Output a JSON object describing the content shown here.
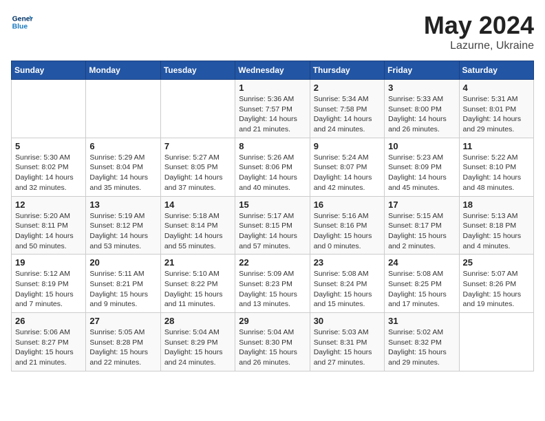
{
  "header": {
    "logo_line1": "General",
    "logo_line2": "Blue",
    "month": "May 2024",
    "location": "Lazurne, Ukraine"
  },
  "weekdays": [
    "Sunday",
    "Monday",
    "Tuesday",
    "Wednesday",
    "Thursday",
    "Friday",
    "Saturday"
  ],
  "weeks": [
    [
      {
        "day": "",
        "info": ""
      },
      {
        "day": "",
        "info": ""
      },
      {
        "day": "",
        "info": ""
      },
      {
        "day": "1",
        "info": "Sunrise: 5:36 AM\nSunset: 7:57 PM\nDaylight: 14 hours\nand 21 minutes."
      },
      {
        "day": "2",
        "info": "Sunrise: 5:34 AM\nSunset: 7:58 PM\nDaylight: 14 hours\nand 24 minutes."
      },
      {
        "day": "3",
        "info": "Sunrise: 5:33 AM\nSunset: 8:00 PM\nDaylight: 14 hours\nand 26 minutes."
      },
      {
        "day": "4",
        "info": "Sunrise: 5:31 AM\nSunset: 8:01 PM\nDaylight: 14 hours\nand 29 minutes."
      }
    ],
    [
      {
        "day": "5",
        "info": "Sunrise: 5:30 AM\nSunset: 8:02 PM\nDaylight: 14 hours\nand 32 minutes."
      },
      {
        "day": "6",
        "info": "Sunrise: 5:29 AM\nSunset: 8:04 PM\nDaylight: 14 hours\nand 35 minutes."
      },
      {
        "day": "7",
        "info": "Sunrise: 5:27 AM\nSunset: 8:05 PM\nDaylight: 14 hours\nand 37 minutes."
      },
      {
        "day": "8",
        "info": "Sunrise: 5:26 AM\nSunset: 8:06 PM\nDaylight: 14 hours\nand 40 minutes."
      },
      {
        "day": "9",
        "info": "Sunrise: 5:24 AM\nSunset: 8:07 PM\nDaylight: 14 hours\nand 42 minutes."
      },
      {
        "day": "10",
        "info": "Sunrise: 5:23 AM\nSunset: 8:09 PM\nDaylight: 14 hours\nand 45 minutes."
      },
      {
        "day": "11",
        "info": "Sunrise: 5:22 AM\nSunset: 8:10 PM\nDaylight: 14 hours\nand 48 minutes."
      }
    ],
    [
      {
        "day": "12",
        "info": "Sunrise: 5:20 AM\nSunset: 8:11 PM\nDaylight: 14 hours\nand 50 minutes."
      },
      {
        "day": "13",
        "info": "Sunrise: 5:19 AM\nSunset: 8:12 PM\nDaylight: 14 hours\nand 53 minutes."
      },
      {
        "day": "14",
        "info": "Sunrise: 5:18 AM\nSunset: 8:14 PM\nDaylight: 14 hours\nand 55 minutes."
      },
      {
        "day": "15",
        "info": "Sunrise: 5:17 AM\nSunset: 8:15 PM\nDaylight: 14 hours\nand 57 minutes."
      },
      {
        "day": "16",
        "info": "Sunrise: 5:16 AM\nSunset: 8:16 PM\nDaylight: 15 hours\nand 0 minutes."
      },
      {
        "day": "17",
        "info": "Sunrise: 5:15 AM\nSunset: 8:17 PM\nDaylight: 15 hours\nand 2 minutes."
      },
      {
        "day": "18",
        "info": "Sunrise: 5:13 AM\nSunset: 8:18 PM\nDaylight: 15 hours\nand 4 minutes."
      }
    ],
    [
      {
        "day": "19",
        "info": "Sunrise: 5:12 AM\nSunset: 8:19 PM\nDaylight: 15 hours\nand 7 minutes."
      },
      {
        "day": "20",
        "info": "Sunrise: 5:11 AM\nSunset: 8:21 PM\nDaylight: 15 hours\nand 9 minutes."
      },
      {
        "day": "21",
        "info": "Sunrise: 5:10 AM\nSunset: 8:22 PM\nDaylight: 15 hours\nand 11 minutes."
      },
      {
        "day": "22",
        "info": "Sunrise: 5:09 AM\nSunset: 8:23 PM\nDaylight: 15 hours\nand 13 minutes."
      },
      {
        "day": "23",
        "info": "Sunrise: 5:08 AM\nSunset: 8:24 PM\nDaylight: 15 hours\nand 15 minutes."
      },
      {
        "day": "24",
        "info": "Sunrise: 5:08 AM\nSunset: 8:25 PM\nDaylight: 15 hours\nand 17 minutes."
      },
      {
        "day": "25",
        "info": "Sunrise: 5:07 AM\nSunset: 8:26 PM\nDaylight: 15 hours\nand 19 minutes."
      }
    ],
    [
      {
        "day": "26",
        "info": "Sunrise: 5:06 AM\nSunset: 8:27 PM\nDaylight: 15 hours\nand 21 minutes."
      },
      {
        "day": "27",
        "info": "Sunrise: 5:05 AM\nSunset: 8:28 PM\nDaylight: 15 hours\nand 22 minutes."
      },
      {
        "day": "28",
        "info": "Sunrise: 5:04 AM\nSunset: 8:29 PM\nDaylight: 15 hours\nand 24 minutes."
      },
      {
        "day": "29",
        "info": "Sunrise: 5:04 AM\nSunset: 8:30 PM\nDaylight: 15 hours\nand 26 minutes."
      },
      {
        "day": "30",
        "info": "Sunrise: 5:03 AM\nSunset: 8:31 PM\nDaylight: 15 hours\nand 27 minutes."
      },
      {
        "day": "31",
        "info": "Sunrise: 5:02 AM\nSunset: 8:32 PM\nDaylight: 15 hours\nand 29 minutes."
      },
      {
        "day": "",
        "info": ""
      }
    ]
  ]
}
